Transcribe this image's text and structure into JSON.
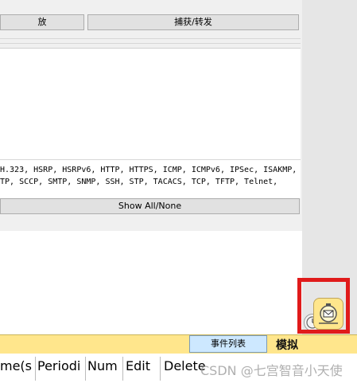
{
  "top_buttons": {
    "left_label": "放",
    "right_label": "捕获/转发"
  },
  "filters": {
    "line1": "H.323, HSRP, HSRPv6, HTTP, HTTPS, ICMP, ICMPv6, IPSec, ISAKMP,",
    "line2": "TP, SCCP, SMTP, SNMP, SSH, STP, TACACS, TCP, TFTP, Telnet,",
    "show_all_label": "Show All/None"
  },
  "bottom_bar": {
    "event_list_tab": "事件列表",
    "simulation_label": "模拟"
  },
  "table_headers": [
    "me(s",
    "Periodi",
    "Num",
    "Edit",
    "Delete"
  ],
  "watermark": "CSDN @七宫智音小天使",
  "icons": {
    "simulation": "simulation-mode-icon",
    "realtime": "realtime-clock-icon"
  }
}
